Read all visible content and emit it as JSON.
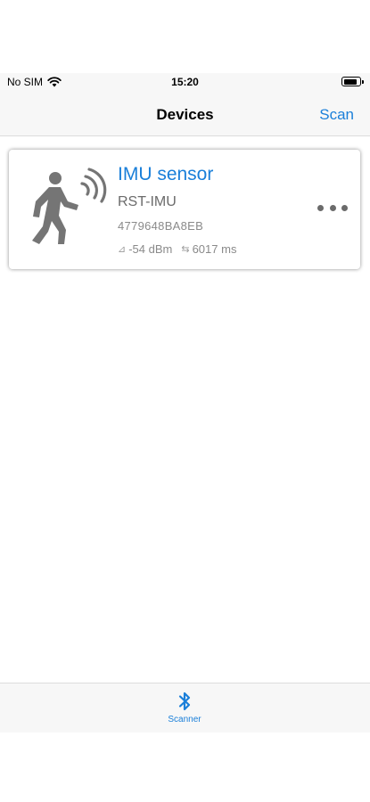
{
  "status_bar": {
    "carrier": "No SIM",
    "time": "15:20",
    "battery_level": 0.9
  },
  "nav": {
    "title": "Devices",
    "scan_label": "Scan"
  },
  "devices": [
    {
      "name": "IMU sensor",
      "model": "RST-IMU",
      "id": "4779648BA8EB",
      "rssi": "-54 dBm",
      "interval": "6017 ms",
      "icon": "walking-person-signal-icon"
    }
  ],
  "tab_bar": {
    "tabs": [
      {
        "label": "Scanner",
        "icon": "bluetooth-icon",
        "active": true
      }
    ]
  },
  "colors": {
    "accent": "#1a7fd9",
    "bar_background": "#f7f7f7",
    "secondary_text": "#6b6b6b"
  }
}
